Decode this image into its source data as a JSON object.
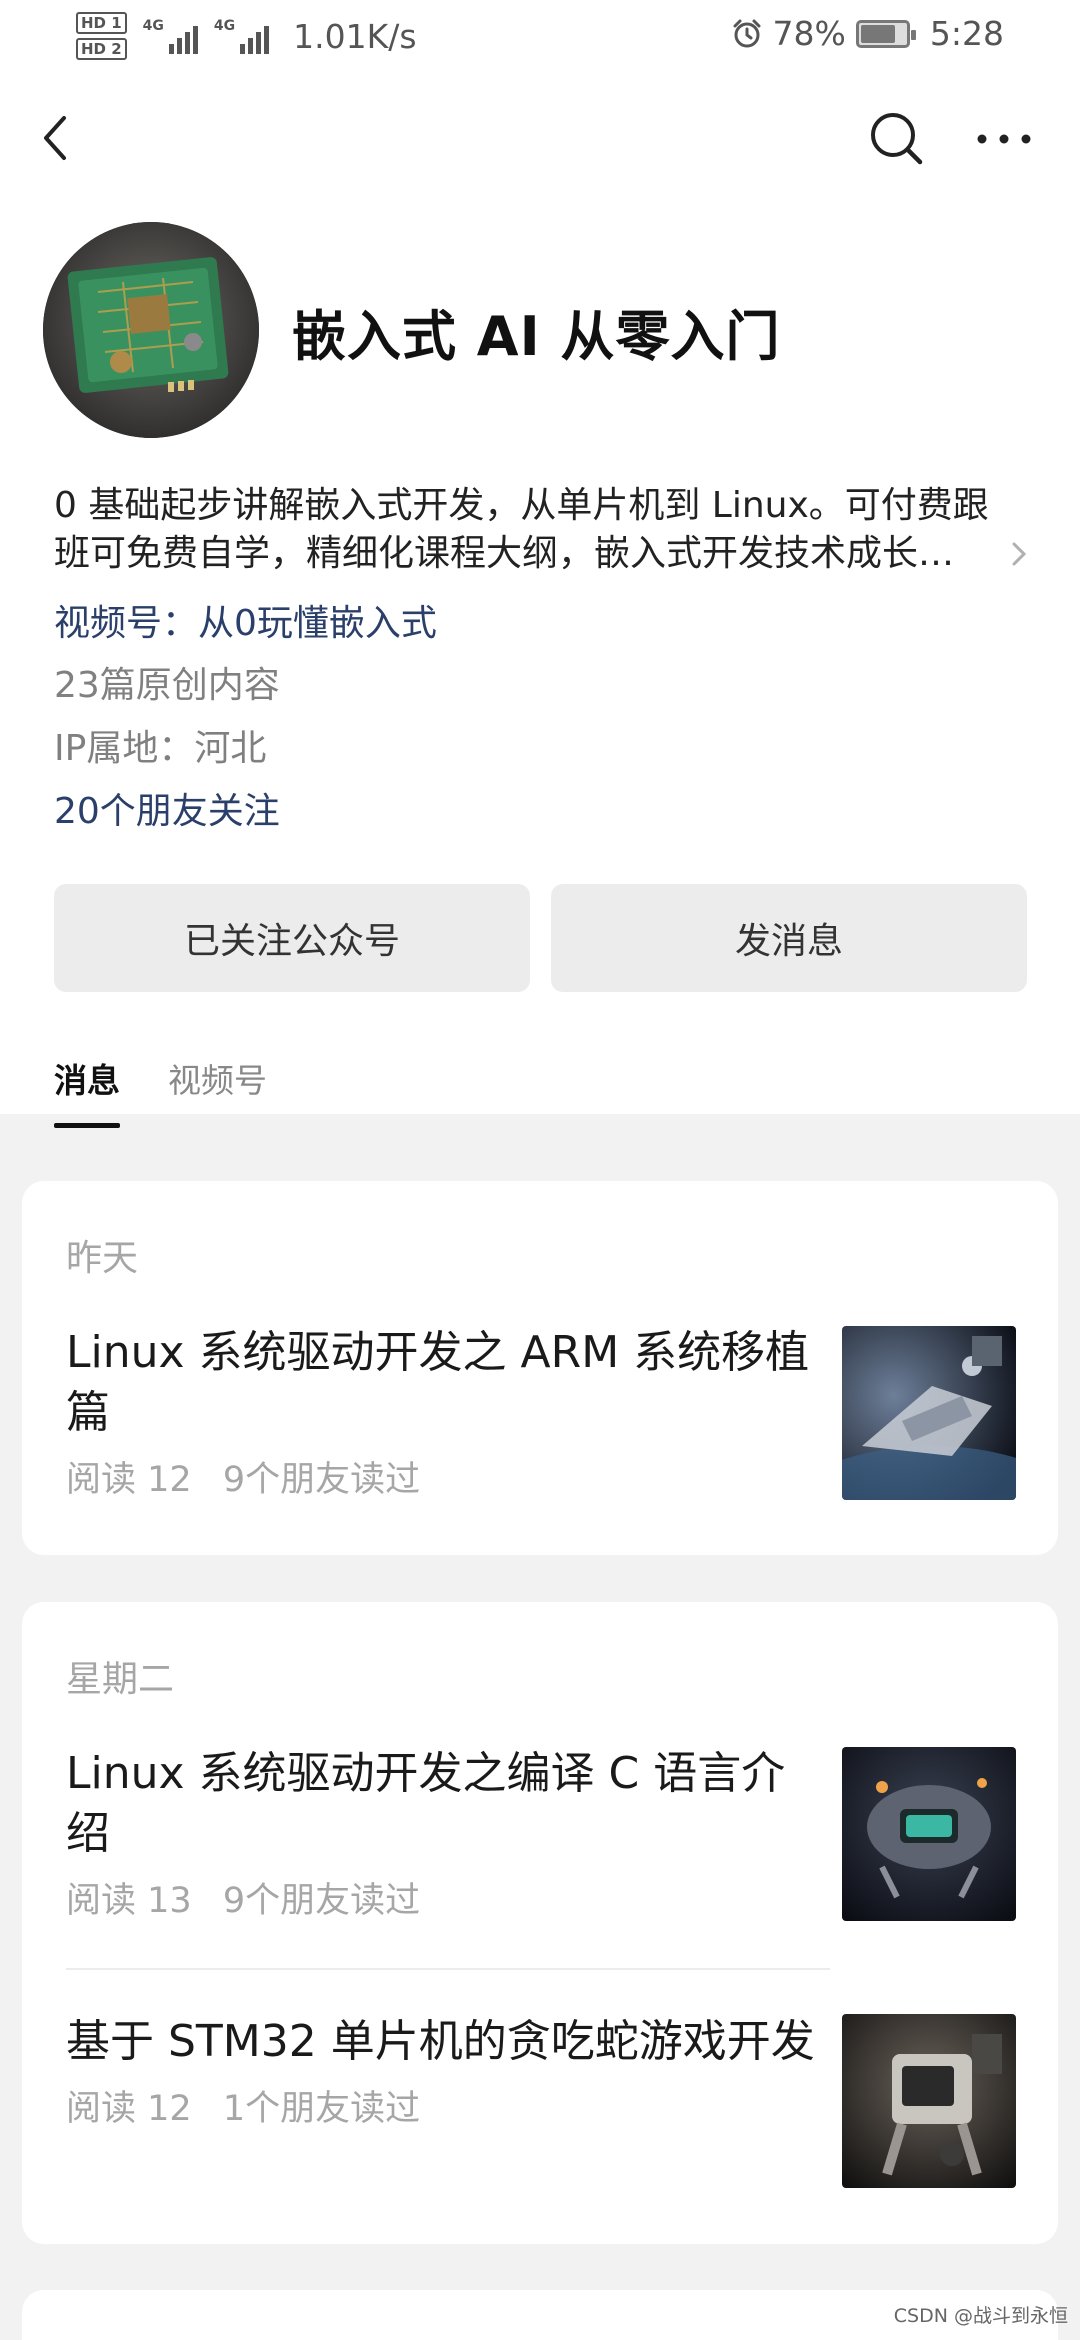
{
  "status_bar": {
    "hd1": "HD 1",
    "hd2": "HD 2",
    "sig1": "4G",
    "sig2": "4G",
    "speed": "1.01K/s",
    "alarm_icon": "alarm-clock-icon",
    "battery_text": "78%",
    "battery_level": 0.78,
    "time": "5:28"
  },
  "nav": {
    "back_icon": "chevron-left-icon",
    "search_icon": "search-icon",
    "more_icon": "more-dots-icon"
  },
  "profile": {
    "name": "嵌入式 AI 从零入门",
    "description_line1": "0 基础起步讲解嵌入式开发，从单片机到 Linux。可付费跟",
    "description_line2": "班可免费自学，精细化课程大纲，嵌入式开发技术成长…",
    "channel": "视频号：从0玩懂嵌入式",
    "original_count": "23篇原创内容",
    "ip_location": "IP属地：河北",
    "friends_following": "20个朋友关注"
  },
  "actions": {
    "followed_label": "已关注公众号",
    "message_label": "发消息"
  },
  "tabs": [
    {
      "label": "消息",
      "active": true
    },
    {
      "label": "视频号",
      "active": false
    }
  ],
  "feed": [
    {
      "day": "昨天",
      "articles": [
        {
          "title": "Linux 系统驱动开发之 ARM 系统移植篇",
          "reads": "阅读 12",
          "friends": "9个朋友读过"
        }
      ]
    },
    {
      "day": "星期二",
      "articles": [
        {
          "title": "Linux 系统驱动开发之编译 C 语言介绍",
          "reads": "阅读 13",
          "friends": "9个朋友读过"
        },
        {
          "title": "基于 STM32 单片机的贪吃蛇游戏开发",
          "reads": "阅读 12",
          "friends": "1个朋友读过"
        }
      ]
    }
  ],
  "watermark": "CSDN @战斗到永恒",
  "colors": {
    "link": "#2a3f6a",
    "muted": "#a6a6a6",
    "background": "#f2f2f2"
  }
}
